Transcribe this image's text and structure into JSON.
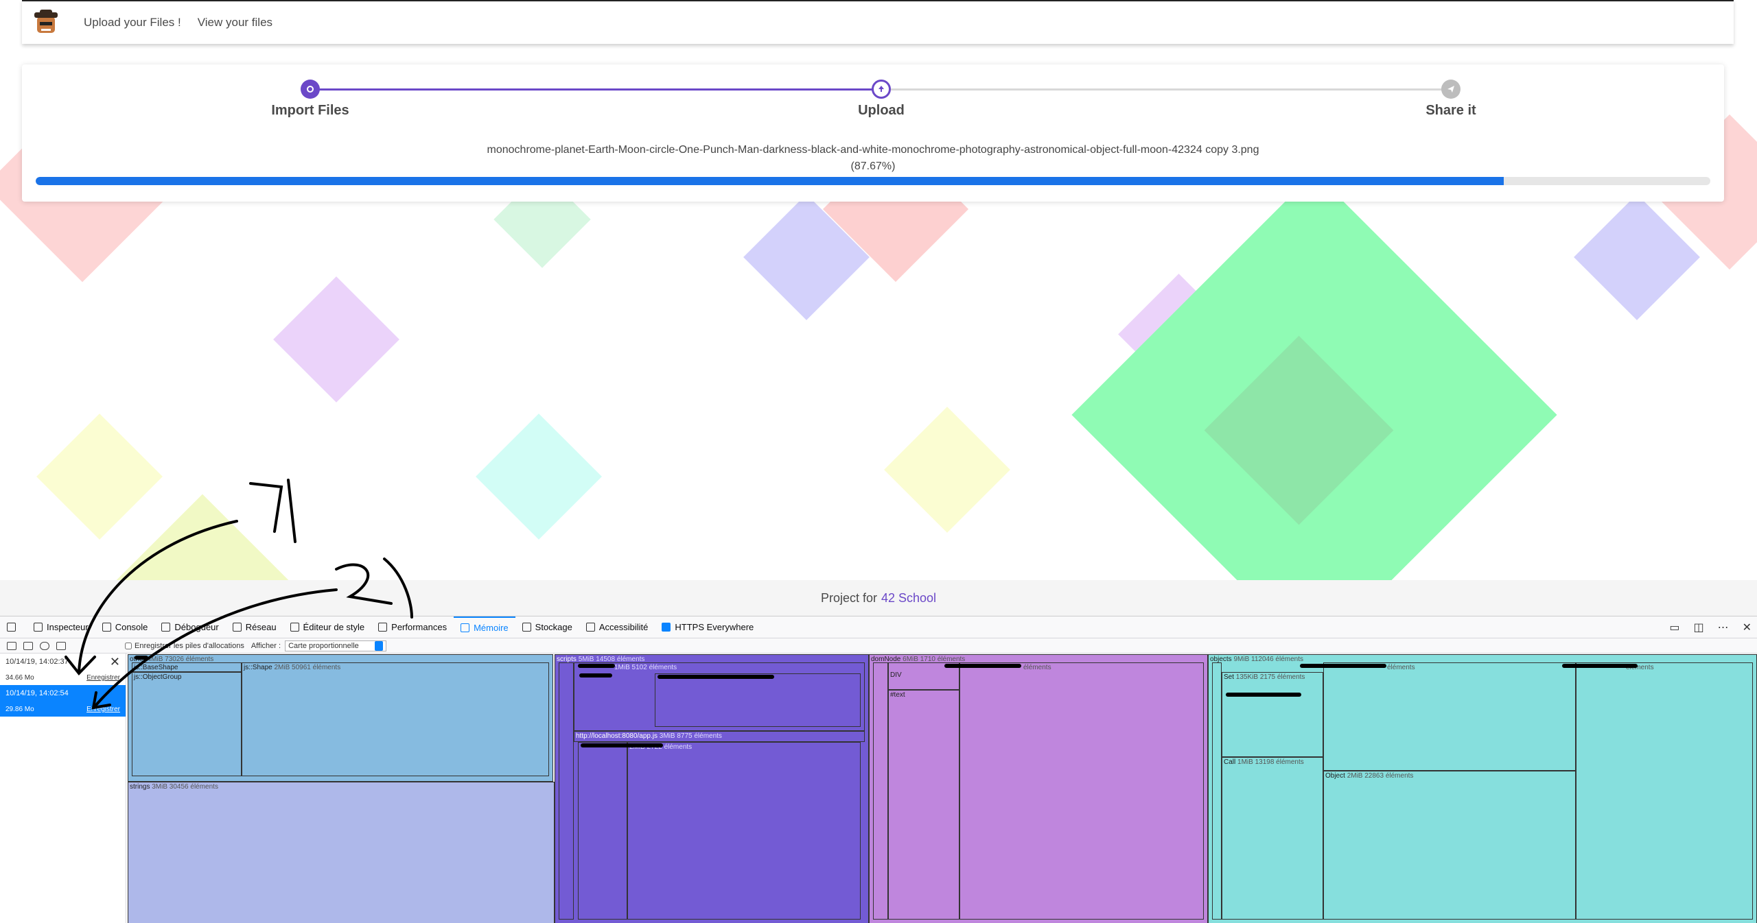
{
  "nav": {
    "links": [
      "Upload your Files !",
      "View your files"
    ]
  },
  "steps": [
    {
      "label": "Import Files"
    },
    {
      "label": "Upload"
    },
    {
      "label": "Share it"
    }
  ],
  "upload": {
    "filename": "monochrome-planet-Earth-Moon-circle-One-Punch-Man-darkness-black-and-white-monochrome-photography-astronomical-object-full-moon-42324 copy 3.png",
    "percent_text": "(87.67%)",
    "progress": 0.8767
  },
  "footer": {
    "prefix": "Project for",
    "link": "42 School"
  },
  "devtools": {
    "tabs": [
      "Inspecteur",
      "Console",
      "Débogueur",
      "Réseau",
      "Éditeur de style",
      "Performances",
      "Mémoire",
      "Stockage",
      "Accessibilité",
      "HTTPS Everywhere"
    ],
    "active_tab": "Mémoire",
    "toolbar": {
      "record_label": "Enregistrer les piles d'allocations",
      "show_label": "Afficher :",
      "view_value": "Carte proportionnelle"
    },
    "snapshots": [
      {
        "date": "10/14/19, 14:02:37",
        "size": "34.66 Mo",
        "save": "Enregistrer"
      },
      {
        "date": "10/14/19, 14:02:54",
        "size": "29.86 Mo",
        "save": "Enregistrer"
      }
    ],
    "treemap": {
      "other": {
        "label": "other",
        "sub": "4MiB 73026 éléments"
      },
      "base_shape": {
        "label": "js::BaseShape"
      },
      "object_group": {
        "label": "js::ObjectGroup"
      },
      "js_shape": {
        "label": "js::Shape",
        "sub": "2MiB 50961 éléments"
      },
      "strings": {
        "label": "strings",
        "sub": "3MiB 30456 éléments"
      },
      "scripts": {
        "label": "scripts",
        "sub": "5MiB 14508 éléments"
      },
      "scripts_a": {
        "sub": "1MiB 5102 éléments"
      },
      "app_js": {
        "label": "http://localhost:8080/app.js",
        "sub": "3MiB 8775 éléments"
      },
      "app_js_inner": {
        "sub": "2MiB 2722 éléments"
      },
      "dom_node": {
        "label": "domNode",
        "sub": "6MiB 1710 éléments"
      },
      "dom_a": {
        "sub": "éléments"
      },
      "div": {
        "label": "DIV"
      },
      "text": {
        "label": "#text"
      },
      "objects": {
        "label": "objects",
        "sub": "9MiB 112046 éléments"
      },
      "set": {
        "label": "Set",
        "sub": "135KiB 2175 éléments"
      },
      "call": {
        "label": "Call",
        "sub": "1MiB 13198 éléments"
      },
      "objects_a": {
        "sub": "éléments"
      },
      "objects_b": {
        "sub": "éléments"
      },
      "object": {
        "label": "Object",
        "sub": "2MiB 22863 éléments"
      }
    }
  },
  "annotations": [
    "1)",
    "2)"
  ],
  "colors": {
    "accent": "#6b48c8",
    "progress": "#1a73e8",
    "devtools_blue": "#0a84ff",
    "tm_other": "#86bbe0",
    "tm_strings": "#aeb8ea",
    "tm_scripts": "#735bd4",
    "tm_dom": "#bf86dd",
    "tm_objects": "#86dfdd"
  }
}
